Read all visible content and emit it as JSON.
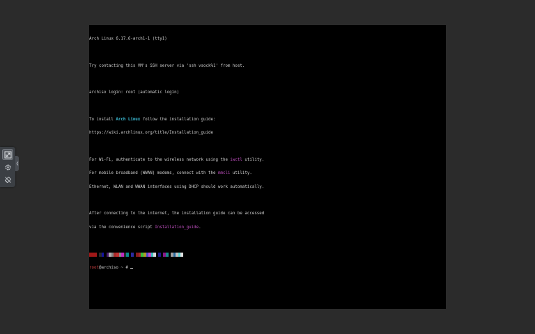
{
  "console": {
    "lines": [
      "Arch Linux 6.17.6-arch1-1 (tty1)",
      "",
      "Try contacting this VM's SSH server via 'ssh vsock%1' from host.",
      "",
      "archiso login: root (automatic login)",
      "",
      "To install Arch Linux follow the installation guide:",
      "https://wiki.archlinux.org/title/Installation_guide",
      "",
      "For Wi-Fi, authenticate to the wireless network using the iwctl utility.",
      "For mobile broadband (WWAN) modems, connect with the mmcli utility.",
      "Ethernet, WLAN and WWAN interfaces using DHCP should work automatically.",
      "",
      "After connecting to the internet, the installation guide can be accessed",
      "via the convenience script Installation_guide."
    ],
    "install_prefix": "To install ",
    "install_brand": "Arch Linux",
    "install_suffix": " follow the installation guide:",
    "wifi_prefix": "For Wi-Fi, authenticate to the wireless network using the ",
    "wifi_cmd": "iwctl",
    "wifi_suffix": " utility.",
    "wwan_prefix": "For mobile broadband (WWAN) modems, connect with the ",
    "wwan_cmd": "mmcli",
    "wwan_suffix": " utility.",
    "guide_prefix": "via the convenience script ",
    "guide_cmd": "Installation_guide",
    "guide_suffix": ".",
    "prompt_user": "root",
    "prompt_host": "@archiso",
    "prompt_tail": " ~ # ",
    "palette": [
      "#a01818",
      "#a01818",
      "#a01818",
      "#000000",
      "#2a2a2a",
      "#1414a0",
      "#000000",
      "#4a1a6a",
      "#b0b0b0",
      "#808080",
      "#a82a2a",
      "#c03030",
      "#8a8a8a",
      "#c02ac0",
      "#2a2a2a",
      "#0a8a8a",
      "#000000",
      "#2a2aa0",
      "#000000",
      "#8a1a1a",
      "#a02a2a",
      "#3ac03a",
      "#b09a2a",
      "#4a4ad0",
      "#c84ac8",
      "#3ac0c0",
      "#dadada",
      "#000000",
      "#1a1a8a",
      "#000000",
      "#8a1a8a",
      "#1a8a8a",
      "#000000",
      "#a0a0a0",
      "#2a6aa0",
      "#c0c0c0",
      "#5ad0d0",
      "#e0e0e0"
    ]
  },
  "toolbar": {
    "buttons": [
      {
        "name": "resize-icon",
        "active": true
      },
      {
        "name": "gear-icon",
        "active": false
      },
      {
        "name": "unlink-icon",
        "active": false
      }
    ]
  },
  "colors": {
    "desktop": "#2b2b2b",
    "screen": "#000000",
    "text": "#d0d0d0",
    "brand": "#3ec6e0",
    "command": "#c04fc0",
    "prompt_user": "#d04040"
  }
}
